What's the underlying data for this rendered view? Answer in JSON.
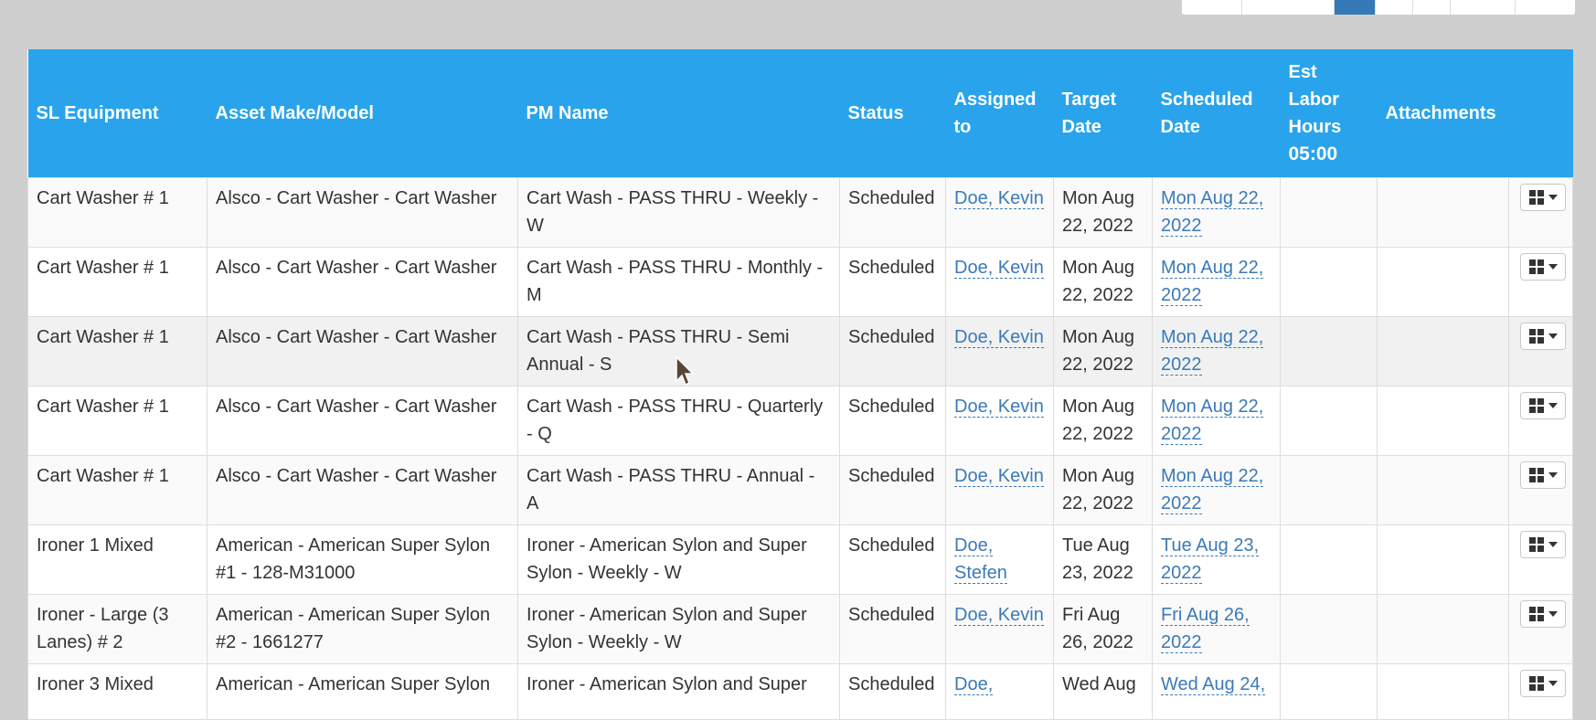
{
  "table": {
    "headers": {
      "equipment": "SL Equipment",
      "make_model": "Asset Make/Model",
      "pm_name": "PM Name",
      "status": "Status",
      "assigned": "Assigned to",
      "target": "Target Date",
      "scheduled": "Scheduled Date",
      "est_labor": "Est Labor Hours",
      "est_labor_total": "05:00",
      "attachments": "Attachments"
    },
    "rows": [
      {
        "equipment": "Cart Washer # 1",
        "make_model": "Alsco - Cart Washer - Cart Washer",
        "pm_name": "Cart Wash - PASS THRU - Weekly - W",
        "status": "Scheduled",
        "assigned": "Doe, Kevin",
        "target": "Mon Aug 22, 2022",
        "scheduled": "Mon Aug 22, 2022"
      },
      {
        "equipment": "Cart Washer # 1",
        "make_model": "Alsco - Cart Washer - Cart Washer",
        "pm_name": "Cart Wash - PASS THRU - Monthly - M",
        "status": "Scheduled",
        "assigned": "Doe, Kevin",
        "target": "Mon Aug 22, 2022",
        "scheduled": "Mon Aug 22, 2022"
      },
      {
        "equipment": "Cart Washer # 1",
        "make_model": "Alsco - Cart Washer - Cart Washer",
        "pm_name": "Cart Wash - PASS THRU - Semi Annual - S",
        "status": "Scheduled",
        "assigned": "Doe, Kevin",
        "target": "Mon Aug 22, 2022",
        "scheduled": "Mon Aug 22, 2022"
      },
      {
        "equipment": "Cart Washer # 1",
        "make_model": "Alsco - Cart Washer - Cart Washer",
        "pm_name": "Cart Wash - PASS THRU - Quarterly - Q",
        "status": "Scheduled",
        "assigned": "Doe, Kevin",
        "target": "Mon Aug 22, 2022",
        "scheduled": "Mon Aug 22, 2022"
      },
      {
        "equipment": "Cart Washer # 1",
        "make_model": "Alsco - Cart Washer - Cart Washer",
        "pm_name": "Cart Wash - PASS THRU - Annual - A",
        "status": "Scheduled",
        "assigned": "Doe, Kevin",
        "target": "Mon Aug 22, 2022",
        "scheduled": "Mon Aug 22, 2022"
      },
      {
        "equipment": "Ironer 1 Mixed",
        "make_model": "American - American Super Sylon #1 - 128-M31000",
        "pm_name": "Ironer - American Sylon and Super Sylon - Weekly - W",
        "status": "Scheduled",
        "assigned": "Doe, Stefen",
        "target": "Tue Aug 23, 2022",
        "scheduled": "Tue Aug 23, 2022"
      },
      {
        "equipment": "Ironer - Large (3 Lanes) # 2",
        "make_model": "American - American Super Sylon #2 - 1661277",
        "pm_name": "Ironer - American Sylon and Super Sylon - Weekly - W",
        "status": "Scheduled",
        "assigned": "Doe, Kevin",
        "target": "Fri Aug 26, 2022",
        "scheduled": "Fri Aug 26, 2022"
      },
      {
        "equipment": "Ironer 3 Mixed",
        "make_model": "American - American Super Sylon",
        "pm_name": "Ironer - American Sylon and Super",
        "status": "Scheduled",
        "assigned": "Doe,",
        "target": "Wed Aug",
        "scheduled": "Wed Aug 24,"
      }
    ]
  }
}
